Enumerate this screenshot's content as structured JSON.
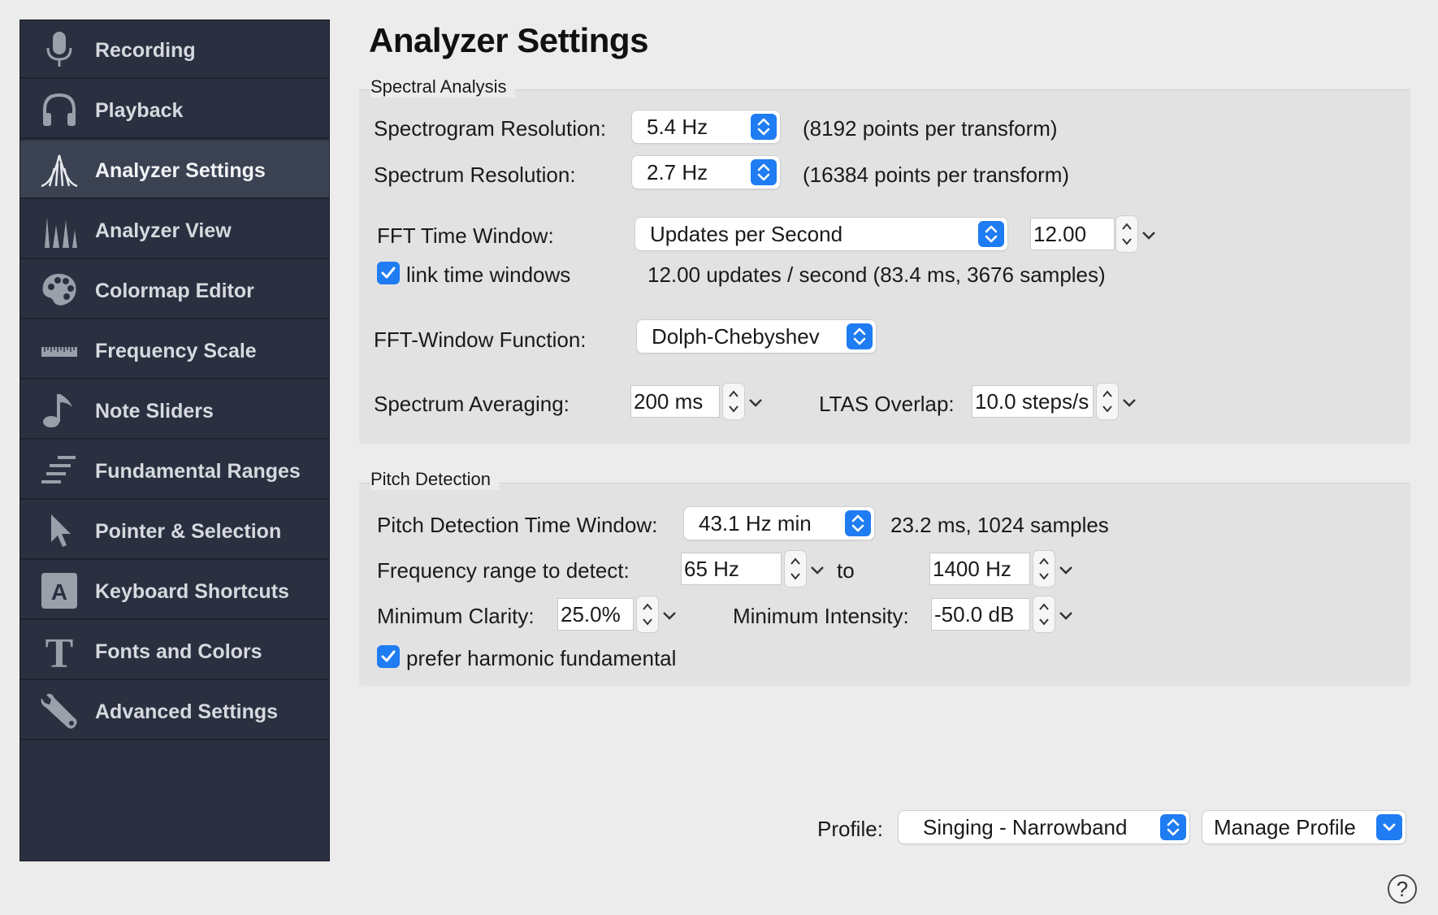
{
  "sidebar": {
    "items": [
      {
        "label": "Recording",
        "icon": "microphone-icon"
      },
      {
        "label": "Playback",
        "icon": "headphones-icon"
      },
      {
        "label": "Analyzer Settings",
        "icon": "spectrum-analyzer-icon",
        "active": true
      },
      {
        "label": "Analyzer View",
        "icon": "peaks-icon"
      },
      {
        "label": "Colormap Editor",
        "icon": "palette-icon"
      },
      {
        "label": "Frequency Scale",
        "icon": "ruler-icon"
      },
      {
        "label": "Note Sliders",
        "icon": "music-note-icon"
      },
      {
        "label": "Fundamental Ranges",
        "icon": "ranges-icon"
      },
      {
        "label": "Pointer & Selection",
        "icon": "pointer-icon"
      },
      {
        "label": "Keyboard Shortcuts",
        "icon": "keyboard-key-icon"
      },
      {
        "label": "Fonts and Colors",
        "icon": "font-icon"
      },
      {
        "label": "Advanced Settings",
        "icon": "wrench-icon"
      }
    ]
  },
  "main": {
    "title": "Analyzer Settings",
    "spectral": {
      "group_title": "Spectral Analysis",
      "spectrogram_resolution": {
        "label": "Spectrogram Resolution:",
        "value": "5.4 Hz",
        "note": "(8192 points per transform)"
      },
      "spectrum_resolution": {
        "label": "Spectrum Resolution:",
        "value": "2.7 Hz",
        "note": "(16384 points per transform)"
      },
      "fft_time_window": {
        "label": "FFT Time Window:",
        "mode": "Updates per Second",
        "value": "12.00"
      },
      "link_time_windows": {
        "label": "link time windows",
        "checked": true,
        "info": "12.00 updates / second (83.4 ms, 3676 samples)"
      },
      "fft_window_function": {
        "label": "FFT-Window Function:",
        "value": "Dolph-Chebyshev"
      },
      "spectrum_averaging": {
        "label": "Spectrum Averaging:",
        "value": "200 ms"
      },
      "ltas_overlap": {
        "label": "LTAS Overlap:",
        "value": "10.0 steps/s"
      }
    },
    "pitch": {
      "group_title": "Pitch Detection",
      "time_window": {
        "label": "Pitch Detection Time Window:",
        "value": "43.1 Hz min",
        "note": "23.2 ms, 1024 samples"
      },
      "frequency_range": {
        "label": "Frequency range to detect:",
        "min": "65 Hz",
        "to": "to",
        "max": "1400 Hz"
      },
      "minimum_clarity": {
        "label": "Minimum Clarity:",
        "value": "25.0%"
      },
      "minimum_intensity": {
        "label": "Minimum Intensity:",
        "value": "-50.0 dB"
      },
      "prefer_harmonic": {
        "label": "prefer harmonic fundamental",
        "checked": true
      }
    },
    "footer": {
      "profile_label": "Profile:",
      "profile_value": "Singing - Narrowband",
      "manage_label": "Manage Profile",
      "help": "?"
    }
  },
  "colors": {
    "sidebar_bg": "#2a3040",
    "sidebar_active": "#3b4252",
    "accent": "#1f7cf2",
    "window_bg": "#ececec",
    "group_bg": "#e2e2e2"
  }
}
